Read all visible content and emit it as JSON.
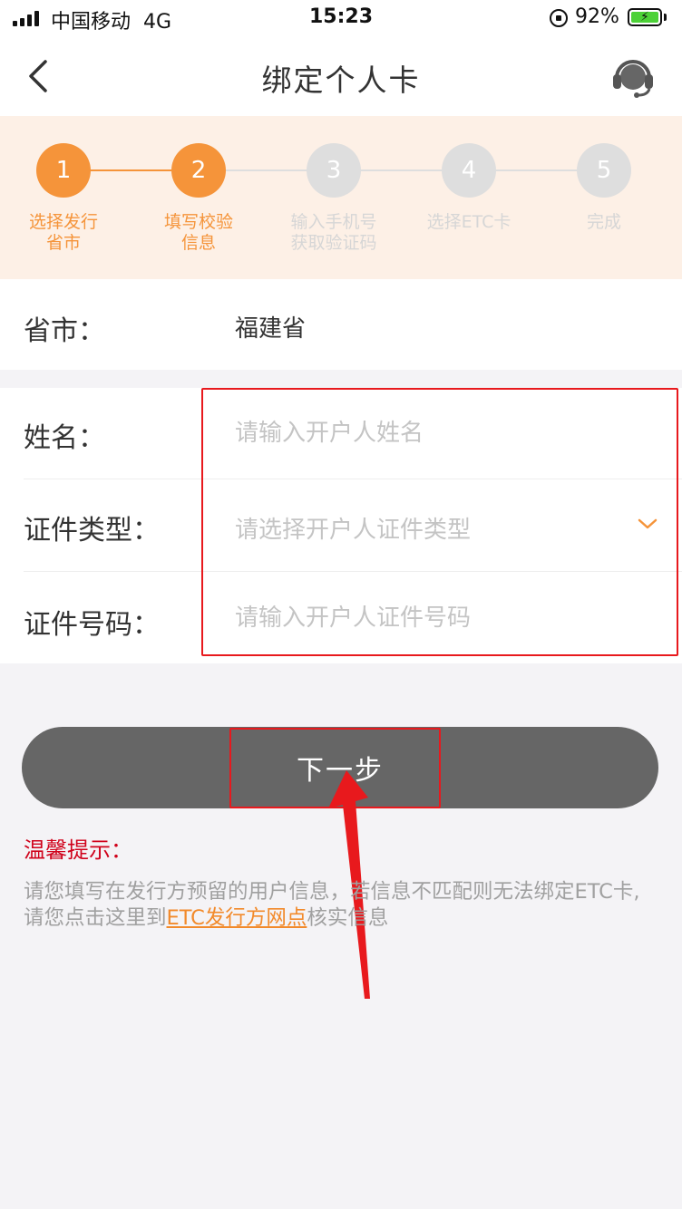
{
  "status_bar": {
    "carrier": "中国移动",
    "network": "4G",
    "time": "15:23",
    "battery_percent": "92%"
  },
  "nav": {
    "title": "绑定个人卡",
    "icons": {
      "back": "chevron-left-icon",
      "service": "headset-icon"
    }
  },
  "steps": [
    {
      "number": "1",
      "label_line1": "选择发行",
      "label_line2": "省市",
      "state": "done"
    },
    {
      "number": "2",
      "label_line1": "填写校验",
      "label_line2": "信息",
      "state": "active"
    },
    {
      "number": "3",
      "label_line1": "输入手机号",
      "label_line2": "获取验证码",
      "state": "pending"
    },
    {
      "number": "4",
      "label_line1": "选择ETC卡",
      "label_line2": "",
      "state": "pending"
    },
    {
      "number": "5",
      "label_line1": "完成",
      "label_line2": "",
      "state": "pending"
    }
  ],
  "province": {
    "label": "省市：",
    "value": "福建省"
  },
  "form": {
    "name": {
      "label": "姓名：",
      "placeholder": "请输入开户人姓名"
    },
    "id_type": {
      "label": "证件类型：",
      "placeholder": "请选择开户人证件类型"
    },
    "id_number": {
      "label": "证件号码：",
      "placeholder": "请输入开户人证件号码"
    }
  },
  "next_button": {
    "label": "下一步"
  },
  "tips": {
    "title": "温馨提示：",
    "text_before": "请您填写在发行方预留的用户信息，若信息不匹配则无法绑定ETC卡,请您点击这里到",
    "link": "ETC发行方网点",
    "text_after": "核实信息"
  },
  "colors": {
    "accent": "#f5943a",
    "stepper_bg": "#fdf0e6",
    "inactive": "#dedede",
    "button": "#666666",
    "annotation_red": "#e8191d",
    "tips_red": "#d0021b",
    "link": "#f28a2b"
  }
}
